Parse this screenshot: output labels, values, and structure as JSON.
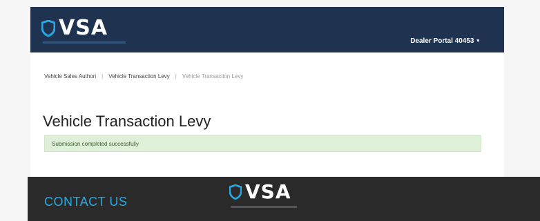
{
  "brand": {
    "name": "VSA"
  },
  "header": {
    "account_label": "Dealer Portal 40453"
  },
  "breadcrumb": {
    "items": [
      "Vehicle Sales Authori",
      "Vehicle Transaction Levy"
    ],
    "current": "Vehicle Transaction Levy"
  },
  "main": {
    "title": "Vehicle Transaction Levy",
    "alert": "Submission completed successfully"
  },
  "footer": {
    "contact_label": "CONTACT US"
  },
  "colors": {
    "header_bg": "#1f3350",
    "accent": "#27a9e1",
    "success_bg": "#dff0d8",
    "footer_bg": "#2a2a2a"
  }
}
